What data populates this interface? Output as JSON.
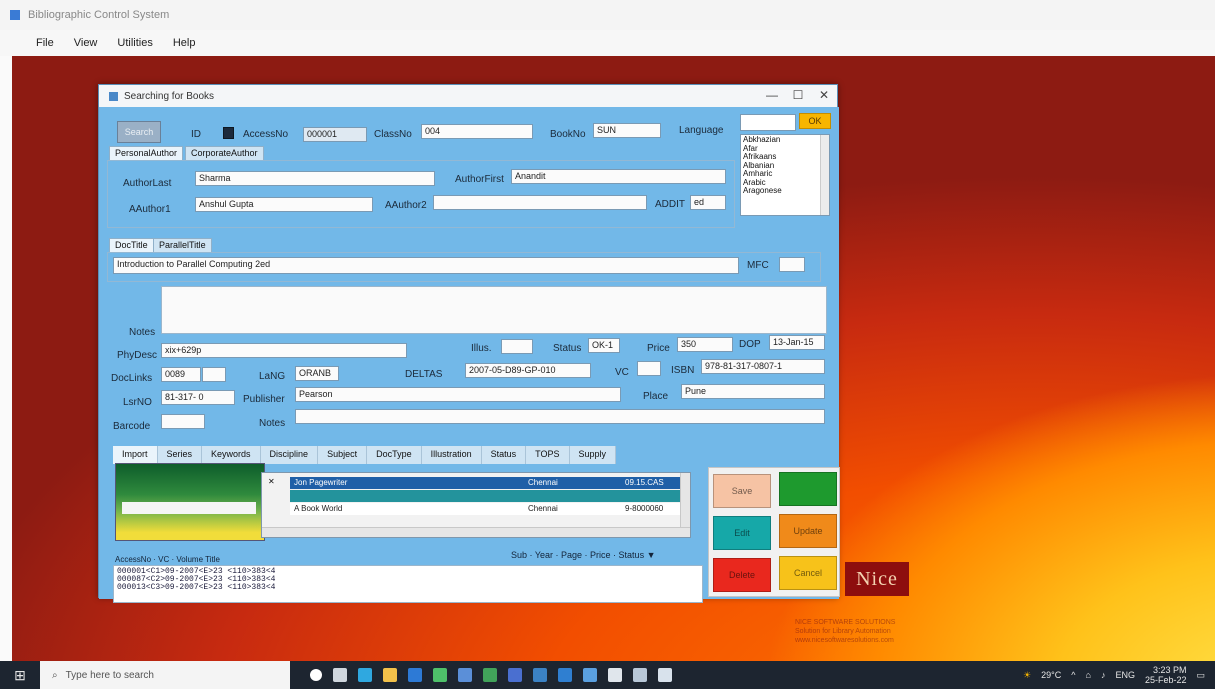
{
  "outer_window": {
    "title": "Bibliographic Control System",
    "menu": [
      "File",
      "View",
      "Utilities",
      "Help"
    ]
  },
  "child_window": {
    "title": "Searching for Books",
    "controls": {
      "minimize": "—",
      "maximize": "☐",
      "close": "✕"
    }
  },
  "search_row": {
    "search_button": "Search",
    "id_label": "ID",
    "accession_label": "AccessNo",
    "accession_value": "000001",
    "class_label": "ClassNo",
    "class_value": "004",
    "book_no_label": "BookNo",
    "book_no_value": "SUN",
    "language_label": "Language",
    "ok_button": "OK",
    "languages": [
      "Abkhazian",
      "Afar",
      "Afrikaans",
      "Albanian",
      "Amharic",
      "Arabic",
      "Aragonese"
    ]
  },
  "author_tabs": [
    "PersonalAuthor",
    "CorporateAuthor"
  ],
  "author": {
    "last_label": "AuthorLast",
    "last_value": "Sharma",
    "first_label": "AuthorFirst",
    "first_value": "Anandit",
    "author1_label": "AAuthor1",
    "author1_value": "Anshul Gupta",
    "author2_label": "AAuthor2",
    "author2_value": "",
    "addit_label": "ADDIT",
    "addit_value": "ed"
  },
  "title_tabs": [
    "DocTitle",
    "ParallelTitle"
  ],
  "title": {
    "value": "Introduction to Parallel Computing 2ed",
    "mfc_label": "MFC",
    "mfc_value": ""
  },
  "notes_label": "Notes",
  "details": {
    "phydesc_label": "PhyDesc",
    "phydesc_value": "xix+629p",
    "ill_label": "Illus.",
    "ill_value": "",
    "status_label": "Status",
    "status_value": "OK-1",
    "price_label": "Price",
    "price_value": "350",
    "dop_label": "DOP",
    "dop_value": "13-Jan-15",
    "doclink_label": "DocLinks",
    "doclink_value": "0089",
    "lang_label": "LaNG",
    "lang_value": "ORANB",
    "deltas_label": "DELTAS",
    "deltas_value": "2007-05-D89-GP-010",
    "vc_label": "VC",
    "vc_value": "",
    "isbn_label": "ISBN",
    "isbn_value": "978-81-317-0807-1",
    "lsrno_label": "LsrNO",
    "lsrno_value": "81-317- 0",
    "publisher_label": "Publisher",
    "publisher_value": "Pearson",
    "place_label": "Place",
    "place_value": "Pune",
    "barcode_label": "Barcode",
    "barcode_value": "",
    "notes2_label": "Notes",
    "notes2_value": ""
  },
  "bottom_tabs": [
    "Import",
    "Series",
    "Keywords",
    "Discipline",
    "Subject",
    "DocType",
    "Illustration",
    "Status",
    "TOPS",
    "Supply"
  ],
  "grid_rows": [
    {
      "c1": "Jon Pagewriter",
      "c2": "Chennai",
      "c3": "09.15.CAS",
      "color": "#1f5fa7"
    },
    {
      "c1": "",
      "c2": "",
      "c3": "",
      "color": "#23939c"
    },
    {
      "c1": "A Book World",
      "c2": "Chennai",
      "c3": "9-8000060",
      "color": "#ffffff"
    }
  ],
  "sub_header": "Sub · Year · Page · Price · Status ▼",
  "acc_header": "AccessNo  ·  VC  ·  Volume Title",
  "acc_rows": [
    "000001<C1>09-2007<E>23     <110>383<4",
    "000087<C2>09-2007<E>23     <110>383<4",
    "000013<C3>09-2007<E>23     <110>383<4"
  ],
  "actions": {
    "save": "Save",
    "add": "",
    "edit": "Edit",
    "update": "Update",
    "delete": "Delete",
    "cancel": "Cancel",
    "colors": {
      "save": "#f6c3a4",
      "add": "#1e9a2e",
      "edit": "#16a8a8",
      "update": "#f08a1a",
      "delete": "#e9281e",
      "cancel": "#f7c21a"
    }
  },
  "overlay": {
    "logo_text": "Nice",
    "stamp_text": "NICE SOFTWARE SOLUTIONS\nSolution for Library Automation\nwww.nicesoftwaresolutions.com"
  },
  "taskbar": {
    "search_placeholder": "Type here to search",
    "weather": "29°C",
    "lang": "ENG",
    "time": "3:23 PM",
    "date": "25-Feb-22"
  }
}
